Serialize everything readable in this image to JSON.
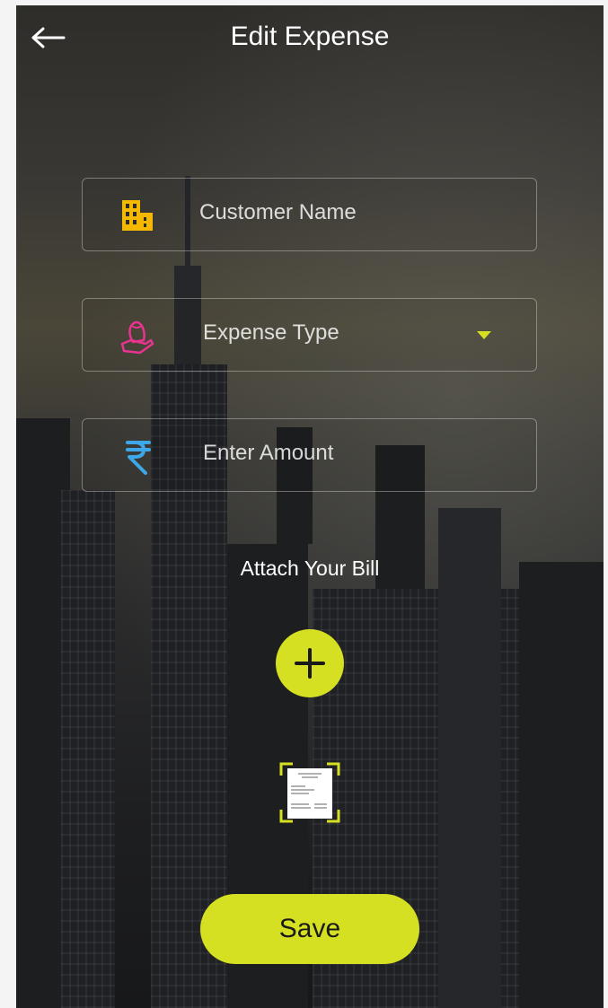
{
  "header": {
    "title": "Edit Expense",
    "back_icon": "arrow-left-icon"
  },
  "form": {
    "customer_name": {
      "placeholder": "Customer Name",
      "icon": "building-icon",
      "icon_color": "#f5b800"
    },
    "expense_type": {
      "placeholder": "Expense Type",
      "icon": "money-bag-hand-icon",
      "icon_color": "#e8338f"
    },
    "amount": {
      "placeholder": "Enter Amount",
      "icon": "rupee-icon",
      "icon_color": "#3ea7e8"
    }
  },
  "attachment": {
    "label": "Attach Your Bill",
    "add_icon": "plus-icon",
    "thumbnail": "receipt-thumbnail"
  },
  "actions": {
    "save_label": "Save"
  },
  "colors": {
    "accent": "#d6e023",
    "text": "#ffffff"
  }
}
